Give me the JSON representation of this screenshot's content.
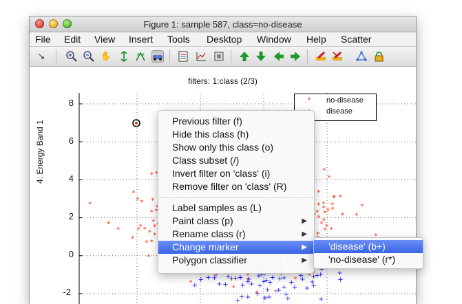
{
  "window": {
    "title": "Figure 1: sample 587, class=no-disease"
  },
  "menubar": {
    "items": [
      "File",
      "Edit",
      "View",
      "Insert",
      "Tools",
      "Desktop",
      "Window",
      "Help",
      "Scatter"
    ]
  },
  "toolbar": {
    "buttons": [
      "arrow-pointer-icon",
      "zoom-in-icon",
      "zoom-out-icon",
      "pan-hand-icon",
      "rotate-3d-icon",
      "data-cursor-icon",
      "brush-icon",
      "insert-colorbar-icon",
      "insert-legend-icon",
      "plot-tools-icon",
      "arrow-up-icon",
      "arrow-down-icon",
      "arrow-left-icon",
      "arrow-right-icon",
      "pen-edit-icon",
      "pen-delete-icon",
      "polygon-icon",
      "lock-icon"
    ]
  },
  "plot": {
    "title": "filters: 1:class (2/3)",
    "ylabel": "4: Energy Band 1",
    "yticks": [
      "8",
      "6",
      "4",
      "2",
      "0",
      "-2"
    ],
    "legend": [
      {
        "marker": "*",
        "label": "no-disease",
        "color": "#ff2a00"
      },
      {
        "marker": "+",
        "label": "disease",
        "color": "#1a1aff"
      }
    ]
  },
  "chart_data": {
    "type": "scatter",
    "title": "filters: 1:class (2/3)",
    "xlabel": "",
    "ylabel": "4: Energy Band 1",
    "ylim": [
      -2.3,
      8.8
    ],
    "grid": true,
    "legend_position": "top-right",
    "series": [
      {
        "name": "no-disease",
        "marker": "*",
        "color": "#ff2a00"
      },
      {
        "name": "disease",
        "marker": "+",
        "color": "#1a1aff"
      }
    ]
  },
  "context_menu": {
    "groups": [
      [
        {
          "label": "Previous filter (f)",
          "submenu": false
        },
        {
          "label": "Hide this class (h)",
          "submenu": false
        },
        {
          "label": "Show only this class (o)",
          "submenu": false
        },
        {
          "label": "Class subset (/)",
          "submenu": false
        },
        {
          "label": "Invert filter on 'class' (i)",
          "submenu": false
        },
        {
          "label": "Remove filter on 'class' (R)",
          "submenu": false
        }
      ],
      [
        {
          "label": "Label samples as (L)",
          "submenu": false
        },
        {
          "label": "Paint class (p)",
          "submenu": true
        },
        {
          "label": "Rename class (r)",
          "submenu": true
        },
        {
          "label": "Change marker",
          "submenu": true,
          "highlighted": true
        },
        {
          "label": "Polygon classifier",
          "submenu": true
        }
      ]
    ],
    "submenu": [
      {
        "label": "'disease' (b+)",
        "highlighted": true
      },
      {
        "label": "'no-disease' (r*)",
        "highlighted": false
      }
    ]
  },
  "colors": {
    "highlight": "#3a64e6",
    "no_disease": "#ff2a00",
    "disease": "#1a1aff"
  }
}
